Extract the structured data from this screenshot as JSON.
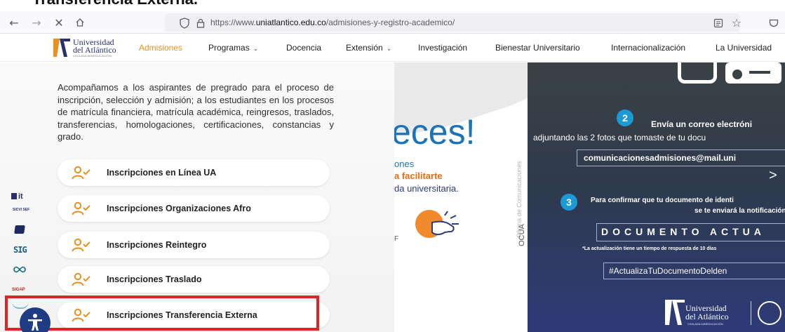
{
  "page_heading": "Transferencia Externa.",
  "browser": {
    "url_prefix": "https://www.",
    "url_domain": "uniatlantico.edu.co",
    "url_path": "/admisiones-y-registro-academico/"
  },
  "logo": {
    "line1": "Universidad",
    "line2": "del Atlántico",
    "sub": "VIGILADA MINEDUCACIÓN"
  },
  "nav": [
    {
      "label": "Admisiones"
    },
    {
      "label": "Programas"
    },
    {
      "label": "Docencia"
    },
    {
      "label": "Extensión"
    },
    {
      "label": "Investigación"
    },
    {
      "label": "Bienestar Universitario"
    },
    {
      "label": "Internacionalización"
    },
    {
      "label": "La Universidad"
    }
  ],
  "description": "Acompañamos a los aspirantes de pregrado para el proceso de inscripción, selección y admisión; a los estudiantes en los procesos de matrícula financiera, matrícula académica, reingresos, traslados, transferencias, homologaciones, certificaciones, constancias y grado.",
  "side_icons": {
    "a": "it",
    "b": "SICVI SEF",
    "c": "SIG",
    "d": "SIGAP"
  },
  "inscriptions": [
    {
      "label": "Inscripciones en Línea UA"
    },
    {
      "label": "Inscripciones Organizaciones Afro"
    },
    {
      "label": "Inscripciones Reintegro"
    },
    {
      "label": "Inscripciones Traslado"
    },
    {
      "label": "Inscripciones Transferencia Externa"
    }
  ],
  "banner_mid": {
    "big_word": "eces!",
    "line1": "ones",
    "line2": "a facilitarte",
    "line3": "da universitaria.",
    "fragment": "F",
    "vertical": "Oficina de Comunicaciones",
    "ocua": "OCUA"
  },
  "banner_right": {
    "step2_num": "2",
    "step2_title": "Envía un correo electróni",
    "step2_text": "adjuntando las 2 fotos que tomaste de tu docu",
    "email": "comunicacionesadmisiones@mail.uni",
    "chevron": ">",
    "step3_num": "3",
    "step3_text": "Para confirmar que tu documento de identi",
    "step3_text2": "se te enviará la notificación",
    "doc_word": "DOCUMENTO ACTUA",
    "note": "*La actualización tiene un tiempo de respuesta de 10 días",
    "hashtag": "#ActualizaTuDocumentoDelden",
    "logo_line1": "Universidad",
    "logo_line2": "del Atlántico",
    "logo_sub": "VIGILADA MINEDUCACIÓN"
  },
  "colors": {
    "accent_orange": "#e8901e",
    "brand_navy": "#2a2f6e",
    "highlight_red": "#e02424"
  }
}
